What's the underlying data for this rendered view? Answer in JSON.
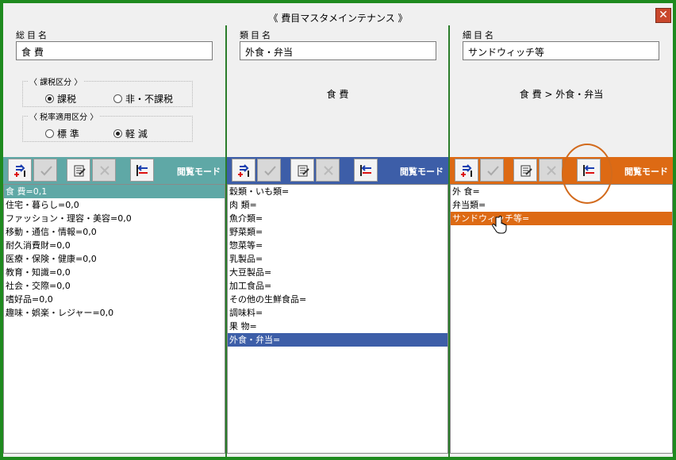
{
  "window": {
    "title": "《 費目マスタメインテナンス 》",
    "close_icon": "close-icon"
  },
  "colors": {
    "teal": "#5fa8a6",
    "blue": "#3d5ea8",
    "orange": "#dd6a14",
    "border": "#1f8a1f"
  },
  "panels": [
    {
      "label": "総目名",
      "value": "食 費",
      "tax_group": {
        "label": "〈 課税区分 〉",
        "options": [
          "課税",
          "非・不課税"
        ],
        "selected": "課税"
      },
      "rate_group": {
        "label": "〈 税率適用区分 〉",
        "options": [
          "標 準",
          "軽 減"
        ],
        "selected": "軽 減"
      },
      "mode": "閲覧モード",
      "items": [
        "食 費=0,1",
        "住宅・暮らし=0,0",
        "ファッション・理容・美容=0,0",
        "移動・通信・情報=0,0",
        "耐久消費財=0,0",
        "医療・保険・健康=0,0",
        "教育・知識=0,0",
        "社会・交際=0,0",
        "嗜好品=0,0",
        "趣味・娯楽・レジャー=0,0"
      ],
      "selected_index": 0
    },
    {
      "label": "類目名",
      "value": "外食・弁当",
      "path": "食 費",
      "mode": "閲覧モード",
      "items": [
        "穀類・いも類=",
        "肉 類=",
        "魚介類=",
        "野菜類=",
        "惣菜等=",
        "乳製品=",
        "大豆製品=",
        "加工食品=",
        "その他の生鮮食品=",
        "調味料=",
        "果 物=",
        "外食・弁当="
      ],
      "selected_index": 11
    },
    {
      "label": "細目名",
      "value": "サンドウィッチ等",
      "path": "食 費 > 外食・弁当",
      "mode": "閲覧モード",
      "items": [
        "外 食=",
        "弁当類=",
        "サンドウィッチ等="
      ],
      "selected_index": 2
    }
  ],
  "toolbar": {
    "icons": [
      "add-record-icon",
      "confirm-icon",
      "edit-icon",
      "delete-icon",
      "mode-switch-icon"
    ]
  }
}
